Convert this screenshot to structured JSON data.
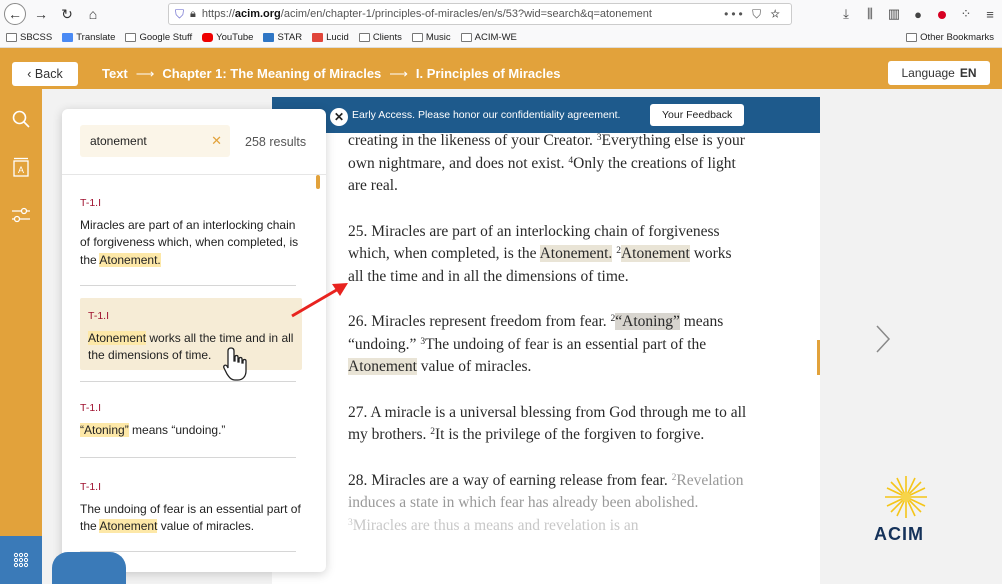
{
  "browser": {
    "url_prefix": "https://",
    "url_host": "acim.org",
    "url_path": "/acim/en/chapter-1/principles-of-miracles/en/s/53?wid=search&q=atonement",
    "url_actions": "••• ⛉ ☆"
  },
  "bookmarks": {
    "items": [
      "SBCSS",
      "Translate",
      "Google Stuff",
      "YouTube",
      "STAR",
      "Lucid",
      "Clients",
      "Music",
      "ACIM-WE"
    ],
    "other": "Other Bookmarks"
  },
  "header": {
    "back_label": "Back",
    "crumb_1": "Text",
    "crumb_2": "Chapter 1: The Meaning of Miracles",
    "crumb_3": "I. Principles of Miracles",
    "language_label": "Language",
    "language_value": "EN"
  },
  "banner": {
    "message": "Early Access. Please honor our confidentiality agreement.",
    "feedback_label": "Your Feedback"
  },
  "search": {
    "query": "atonement",
    "results_count": "258 results",
    "results": [
      {
        "ref": "T-1.I",
        "pre": "Miracles are part of an interlocking chain of forgiveness which, when completed, is the ",
        "match": "Atonement.",
        "post": ""
      },
      {
        "ref": "T-1.I",
        "pre": "",
        "match": "Atonement",
        "post": " works all the time and in all the dimensions of time."
      },
      {
        "ref": "T-1.I",
        "pre": "",
        "match": "“Atoning”",
        "post": " means “undoing.”"
      },
      {
        "ref": "T-1.I",
        "pre": "The undoing of fear is an essential part of the ",
        "match": "Atonement",
        "post": " value of miracles."
      }
    ]
  },
  "reading": {
    "p0_line1": "creating in the likeness of your Creator. ",
    "p0_sup3": "3",
    "p0_line1b": "Everything else is your own nightmare, and does not exist. ",
    "p0_sup4": "4",
    "p0_line2": "Only the creations of light are real.",
    "p25_a": "25. Miracles are part of an interlocking chain of forgiveness which, when completed, is the ",
    "p25_hl1": "Atonement.",
    "p25_sup2": "2",
    "p25_hl2": "Atonement",
    "p25_b": " works all the time and in all the dimensions of time.",
    "p26_a": "26. Miracles represent freedom from fear. ",
    "p26_sup2": "2",
    "p26_hl1": "“Atoning”",
    "p26_b": " means “undoing.” ",
    "p26_sup3": "3",
    "p26_c": "The undoing of fear is an essential part of the ",
    "p26_hl2": "Atonement",
    "p26_d": " value of miracles.",
    "p27_a": "27. A miracle is a universal blessing from God through me to all my brothers. ",
    "p27_sup2": "2",
    "p27_b": "It is the privilege of the forgiven to forgive.",
    "p28_a": "28. Miracles are a way of earning release from fear. ",
    "p28_sup2": "2",
    "p28_b": "Revelation induces a state in which fear has already been abolished. ",
    "p28_sup3": "3",
    "p28_c": "Miracles are thus a means and revelation is an"
  },
  "logo_text": "ACIM"
}
